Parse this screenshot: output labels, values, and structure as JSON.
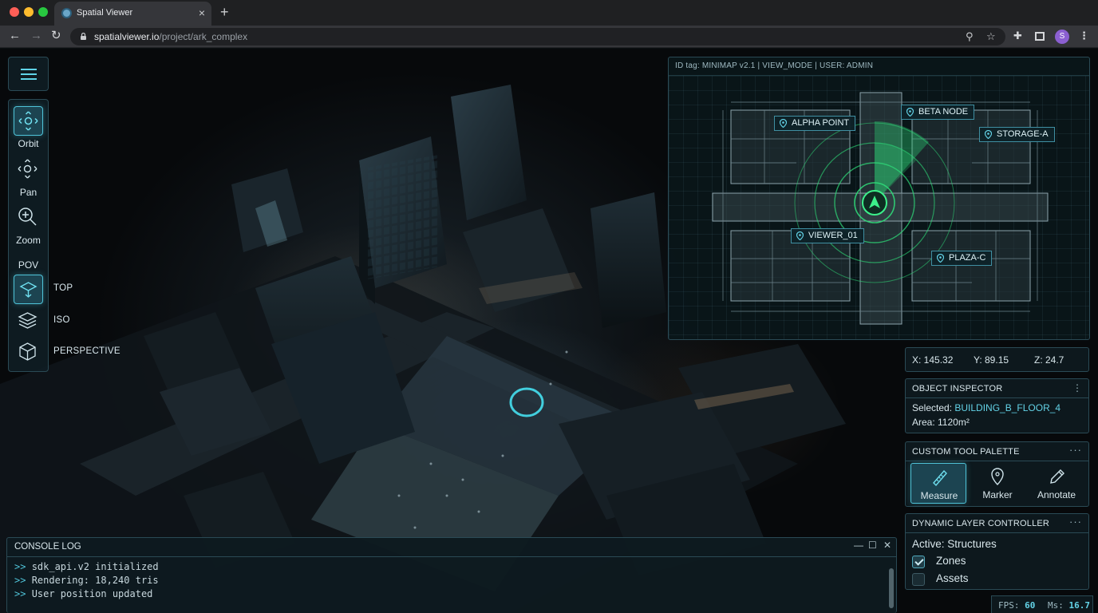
{
  "browser": {
    "tab_title": "Spatial Viewer",
    "url_host": "spatialviewer.io",
    "url_path": "/project/ark_complex",
    "profile_initial": "S"
  },
  "rail": {
    "tools": [
      {
        "label": "Orbit",
        "icon": "orbit-icon",
        "active": true
      },
      {
        "label": "Pan",
        "icon": "pan-icon",
        "active": false
      },
      {
        "label": "Zoom",
        "icon": "zoom-icon",
        "active": false
      }
    ],
    "pov_heading": "POV",
    "pov_modes": [
      {
        "label": "TOP",
        "icon": "top-view-icon",
        "active": true
      },
      {
        "label": "ISO",
        "icon": "layers-icon",
        "active": false
      },
      {
        "label": "PERSPECTIVE",
        "icon": "cube-icon",
        "active": false
      }
    ]
  },
  "minimap": {
    "header": "ID tag: MINIMAP v2.1 | VIEW_MODE | USER: ADMIN",
    "markers": [
      "ALPHA POINT",
      "BETA NODE",
      "STORAGE-A",
      "VIEWER_01",
      "PLAZA-C"
    ]
  },
  "coords": {
    "x": "X: 145.32",
    "y": "Y: 89.15",
    "z": "Z: 24.7"
  },
  "inspector": {
    "title": "OBJECT INSPECTOR",
    "selected_label": "Selected: ",
    "selected_value": "BUILDING_B_FLOOR_4",
    "area": "Area: 1120m²"
  },
  "palette": {
    "title": "CUSTOM TOOL PALETTE",
    "tools": [
      {
        "label": "Measure",
        "icon": "ruler-icon",
        "active": true
      },
      {
        "label": "Marker",
        "icon": "map-pin-icon",
        "active": false
      },
      {
        "label": "Annotate",
        "icon": "pencil-icon",
        "active": false
      }
    ]
  },
  "layers": {
    "title": "DYNAMIC LAYER CONTROLLER",
    "active": "Active: Structures",
    "items": [
      {
        "label": "Zones",
        "checked": true
      },
      {
        "label": "Assets",
        "checked": false
      }
    ]
  },
  "stats": {
    "fps_label": "FPS:",
    "fps": "60",
    "ms_label": "Ms:",
    "ms": "16.7"
  },
  "console": {
    "title": "CONSOLE LOG",
    "prompt": ">>",
    "lines": [
      "sdk_api.v2 initialized",
      "Rendering: 18,240 tris",
      "User position updated"
    ]
  },
  "colors": {
    "accent": "#4fc3d8",
    "radar": "#2fe07a",
    "panel_bg": "#0e1a1f"
  }
}
